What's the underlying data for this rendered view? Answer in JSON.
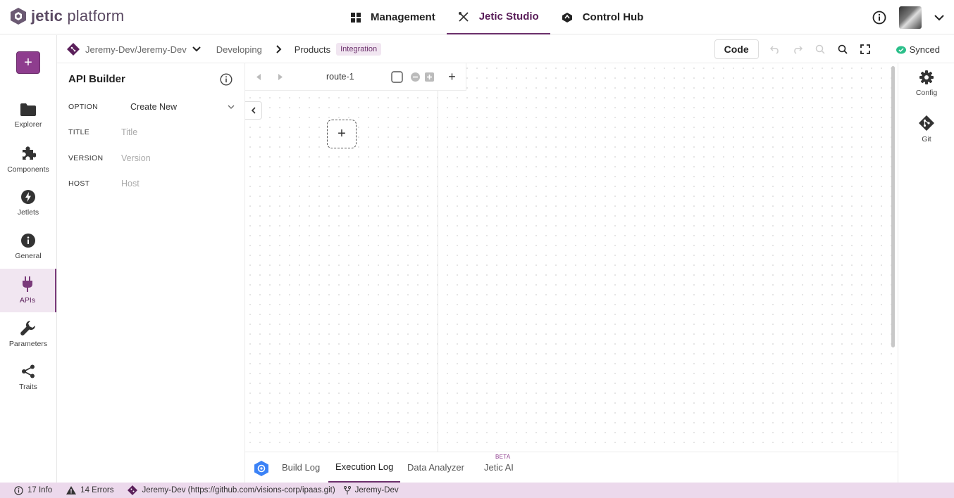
{
  "header": {
    "logo_text_bold": "jetic",
    "logo_text_light": " platform",
    "nav": [
      {
        "label": "Management",
        "icon": "grid-icon"
      },
      {
        "label": "Jetic Studio",
        "icon": "tools-icon"
      },
      {
        "label": "Control Hub",
        "icon": "hexagon-icon"
      }
    ],
    "active_nav": "Jetic Studio"
  },
  "breadcrumb": {
    "repo": "Jeremy-Dev/Jeremy-Dev",
    "stage": "Developing",
    "project": "Products",
    "tag": "Integration"
  },
  "toolbar": {
    "code_label": "Code",
    "sync_label": "Synced"
  },
  "sidebar": {
    "add_label": "+",
    "items": [
      {
        "label": "Explorer",
        "icon": "folder-icon"
      },
      {
        "label": "Components",
        "icon": "puzzle-icon"
      },
      {
        "label": "Jetlets",
        "icon": "bolt-icon"
      },
      {
        "label": "General",
        "icon": "info-icon"
      },
      {
        "label": "APIs",
        "icon": "plug-icon"
      },
      {
        "label": "Parameters",
        "icon": "wrench-icon"
      },
      {
        "label": "Traits",
        "icon": "share-icon"
      }
    ],
    "active": "APIs"
  },
  "api_builder": {
    "title": "API Builder",
    "option_label": "OPTION",
    "option_value": "Create New",
    "title_label": "TITLE",
    "title_placeholder": "Title",
    "version_label": "VERSION",
    "version_placeholder": "Version",
    "host_label": "HOST",
    "host_placeholder": "Host"
  },
  "canvas": {
    "route_title": "route-1",
    "add_route_label": "+",
    "add_step_label": "+"
  },
  "right_rail": {
    "items": [
      {
        "label": "Config",
        "icon": "gear-icon"
      },
      {
        "label": "Git",
        "icon": "git-icon"
      }
    ]
  },
  "bottom_tabs": {
    "tabs": [
      "Build Log",
      "Execution Log",
      "Data Analyzer",
      "Jetic AI"
    ],
    "active": "Execution Log",
    "beta_label": "BETA"
  },
  "statusbar": {
    "info": "17 Info",
    "errors": "14 Errors",
    "repo": "Jeremy-Dev (https://github.com/visions-corp/ipaas.git)",
    "branch": "Jeremy-Dev"
  }
}
